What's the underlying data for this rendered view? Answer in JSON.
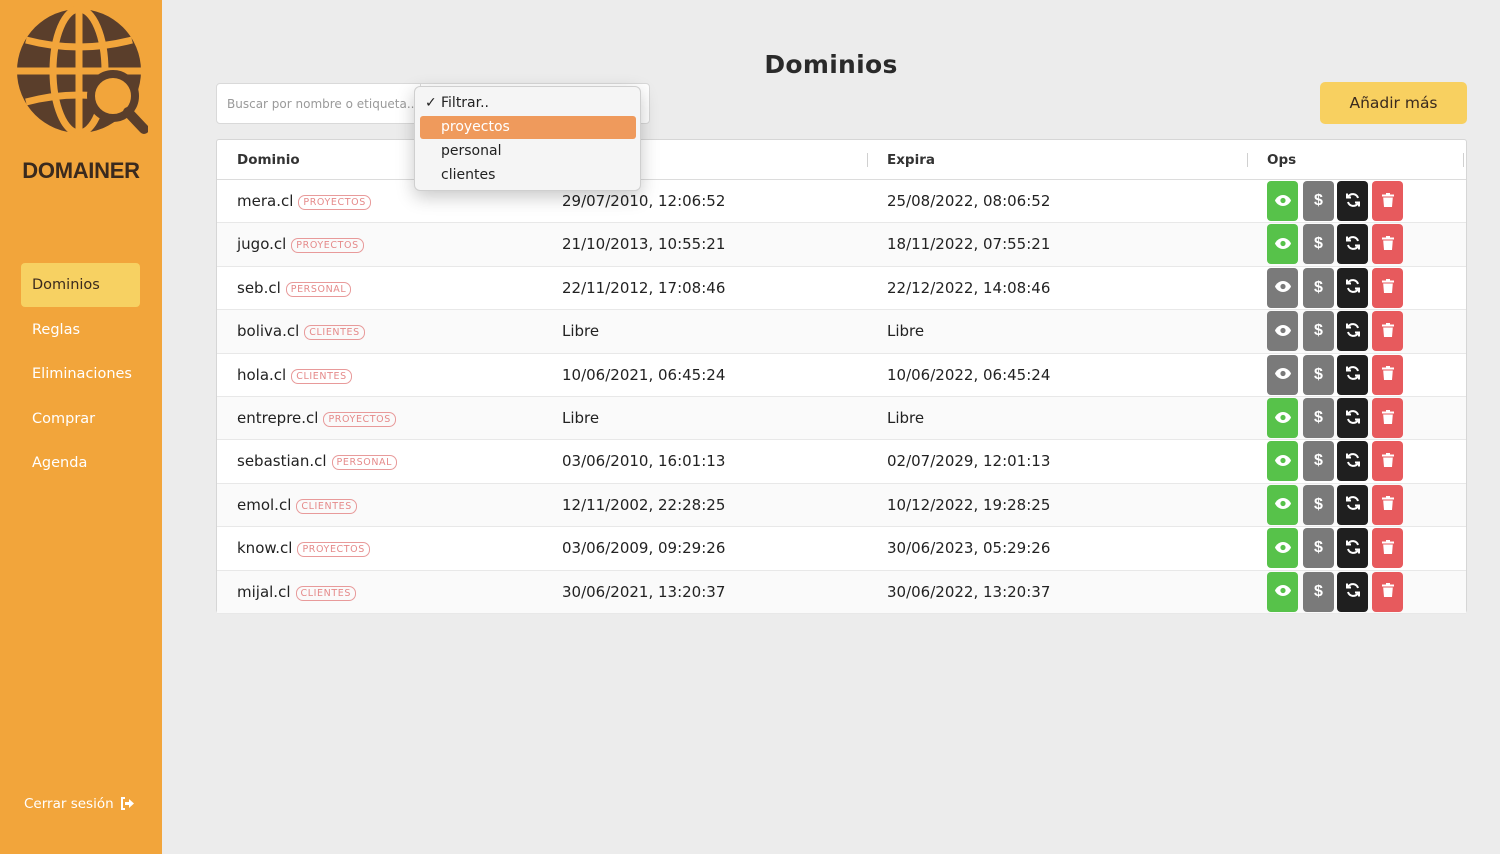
{
  "brand": {
    "name": "DOMAINER"
  },
  "sidebar": {
    "items": [
      {
        "label": "Dominios",
        "active": true
      },
      {
        "label": "Reglas"
      },
      {
        "label": "Eliminaciones"
      },
      {
        "label": "Comprar"
      },
      {
        "label": "Agenda"
      }
    ],
    "logout_label": "Cerrar sesión"
  },
  "page": {
    "title": "Dominios"
  },
  "search": {
    "placeholder": "Buscar por nombre o etiqueta..."
  },
  "filter": {
    "options": [
      "Filtrar..",
      "proyectos",
      "personal",
      "clientes"
    ],
    "selected": "Filtrar..",
    "highlighted": "proyectos"
  },
  "add_button": {
    "label": "Añadir más"
  },
  "table": {
    "headers": {
      "domain": "Dominio",
      "created": "",
      "expires": "Expira",
      "ops": "Ops"
    },
    "rows": [
      {
        "domain": "mera.cl",
        "tag": "PROYECTOS",
        "created": "29/07/2010, 12:06:52",
        "expires": "25/08/2022, 08:06:52",
        "view_active": true
      },
      {
        "domain": "jugo.cl",
        "tag": "PROYECTOS",
        "created": "21/10/2013, 10:55:21",
        "expires": "18/11/2022, 07:55:21",
        "view_active": true
      },
      {
        "domain": "seb.cl",
        "tag": "PERSONAL",
        "created": "22/11/2012, 17:08:46",
        "expires": "22/12/2022, 14:08:46",
        "view_active": false
      },
      {
        "domain": "boliva.cl",
        "tag": "CLIENTES",
        "created": "Libre",
        "expires": "Libre",
        "view_active": false
      },
      {
        "domain": "hola.cl",
        "tag": "CLIENTES",
        "created": "10/06/2021, 06:45:24",
        "expires": "10/06/2022, 06:45:24",
        "view_active": false
      },
      {
        "domain": "entrepre.cl",
        "tag": "PROYECTOS",
        "created": "Libre",
        "expires": "Libre",
        "view_active": true
      },
      {
        "domain": "sebastian.cl",
        "tag": "PERSONAL",
        "created": "03/06/2010, 16:01:13",
        "expires": "02/07/2029, 12:01:13",
        "view_active": true
      },
      {
        "domain": "emol.cl",
        "tag": "CLIENTES",
        "created": "12/11/2002, 22:28:25",
        "expires": "10/12/2022, 19:28:25",
        "view_active": true
      },
      {
        "domain": "know.cl",
        "tag": "PROYECTOS",
        "created": "03/06/2009, 09:29:26",
        "expires": "30/06/2023, 05:29:26",
        "view_active": true
      },
      {
        "domain": "mijal.cl",
        "tag": "CLIENTES",
        "created": "30/06/2021, 13:20:37",
        "expires": "30/06/2022, 13:20:37",
        "view_active": true
      }
    ],
    "ops_money_symbol": "$"
  },
  "colors": {
    "sidebar": "#f2a53b",
    "accent": "#f8d060",
    "view_on": "#57c24a",
    "view_off": "#7a7a7a",
    "renew": "#1f1f1f",
    "delete": "#e75a5d",
    "dropdown_highlight": "#ef9a5c"
  },
  "icons": {
    "logo": "globe-search-icon",
    "logout": "sign-out-icon",
    "view": "eye-icon",
    "money": "dollar-icon",
    "renew": "refresh-icon",
    "delete": "trash-icon",
    "dropdown": "chevron-down-icon",
    "check": "checkmark-icon"
  }
}
